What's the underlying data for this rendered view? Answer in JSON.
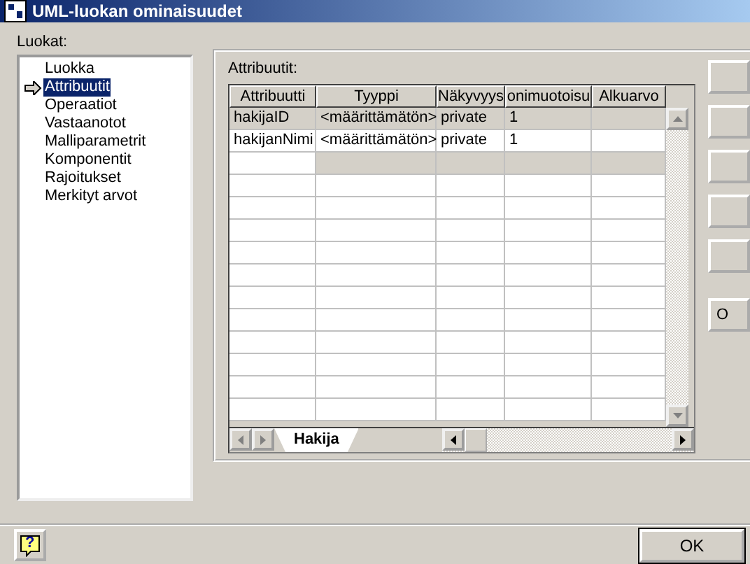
{
  "window": {
    "title": "UML-luokan ominaisuudet"
  },
  "categories": {
    "label": "Luokat:",
    "items": [
      {
        "label": "Luokka",
        "selected": false
      },
      {
        "label": "Attribuutit",
        "selected": true
      },
      {
        "label": "Operaatiot",
        "selected": false
      },
      {
        "label": "Vastaanotot",
        "selected": false
      },
      {
        "label": "Malliparametrit",
        "selected": false
      },
      {
        "label": "Komponentit",
        "selected": false
      },
      {
        "label": "Rajoitukset",
        "selected": false
      },
      {
        "label": "Merkityt arvot",
        "selected": false
      }
    ]
  },
  "attributes": {
    "label": "Attribuutit:",
    "columns": [
      "Attribuutti",
      "Tyyppi",
      "Näkyvyys",
      "onimuotoisu",
      "Alkuarvo"
    ],
    "rows": [
      {
        "cells": [
          "hakijaID",
          "<määrittämätön>",
          "private",
          "1",
          ""
        ],
        "selected": true
      },
      {
        "cells": [
          "hakijanNimi",
          "<määrittämätön>",
          "private",
          "1",
          ""
        ],
        "selected": false
      }
    ],
    "sheet_tabs": [
      {
        "label": "Hakija",
        "selected": true
      }
    ]
  },
  "side_buttons": [
    {
      "label": "O"
    }
  ],
  "buttons": {
    "help": "?",
    "ok": "OK"
  }
}
